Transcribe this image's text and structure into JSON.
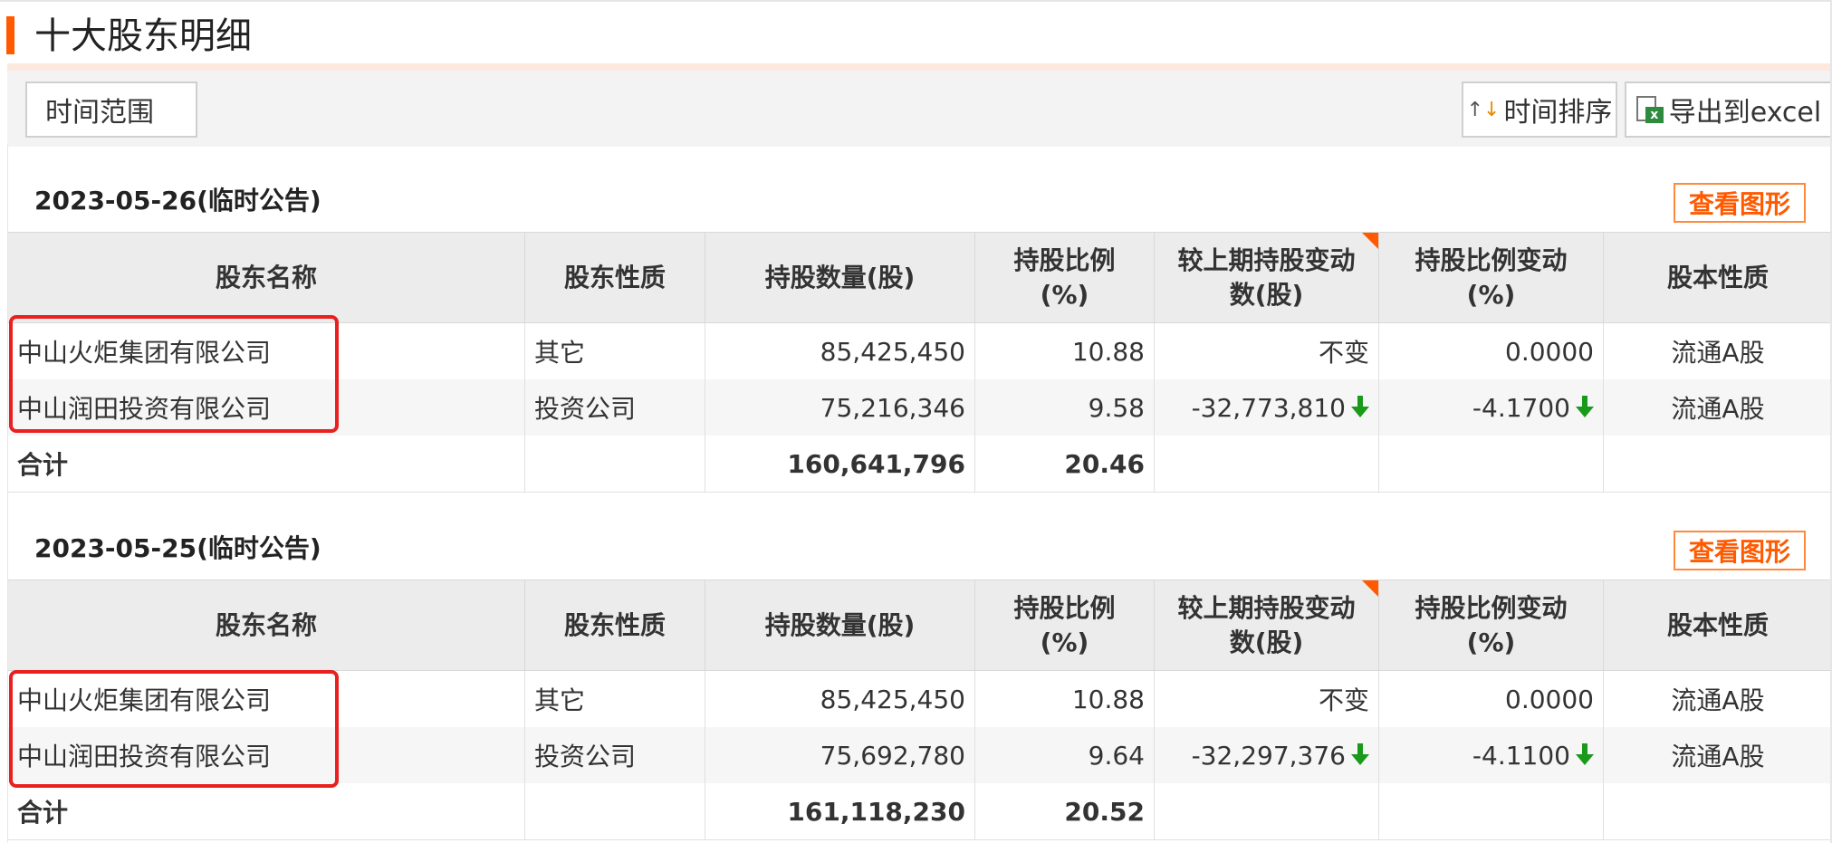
{
  "page_title": "十大股东明细",
  "toolbar": {
    "time_range_label": "时间范围",
    "sort_label": "时间排序",
    "export_label": "导出到excel"
  },
  "colors": {
    "accent": "#ff5a00",
    "increase_decrease_green": "#1a9a1a",
    "highlight_red": "#e82020"
  },
  "icons": {
    "sort": "sort-arrows-icon",
    "export": "excel-file-icon",
    "decrease": "arrow-down-icon"
  },
  "columns": [
    "股东名称",
    "股东性质",
    "持股数量(股)",
    "持股比例(%)",
    "较上期持股变动数(股)",
    "持股比例变动(%)",
    "股本性质"
  ],
  "column_lines": {
    "ratio": [
      "持股比例",
      "(%)"
    ],
    "change_shares": [
      "较上期持股变动",
      "数(股)"
    ],
    "ratio_change": [
      "持股比例变动",
      "(%)"
    ]
  },
  "sections": [
    {
      "date": "2023-05-26(临时公告)",
      "chart_button": "查看图形",
      "rows": [
        {
          "name": "中山火炬集团有限公司",
          "type": "其它",
          "shares": "85,425,450",
          "ratio": "10.88",
          "change": "不变",
          "ratio_change": "0.0000",
          "share_class": "流通A股",
          "decreased": false
        },
        {
          "name": "中山润田投资有限公司",
          "type": "投资公司",
          "shares": "75,216,346",
          "ratio": "9.58",
          "change": "-32,773,810",
          "ratio_change": "-4.1700",
          "share_class": "流通A股",
          "decreased": true
        }
      ],
      "total": {
        "label": "合计",
        "shares": "160,641,796",
        "ratio": "20.46"
      }
    },
    {
      "date": "2023-05-25(临时公告)",
      "chart_button": "查看图形",
      "rows": [
        {
          "name": "中山火炬集团有限公司",
          "type": "其它",
          "shares": "85,425,450",
          "ratio": "10.88",
          "change": "不变",
          "ratio_change": "0.0000",
          "share_class": "流通A股",
          "decreased": false
        },
        {
          "name": "中山润田投资有限公司",
          "type": "投资公司",
          "shares": "75,692,780",
          "ratio": "9.64",
          "change": "-32,297,376",
          "ratio_change": "-4.1100",
          "share_class": "流通A股",
          "decreased": true
        }
      ],
      "total": {
        "label": "合计",
        "shares": "161,118,230",
        "ratio": "20.52"
      }
    }
  ]
}
